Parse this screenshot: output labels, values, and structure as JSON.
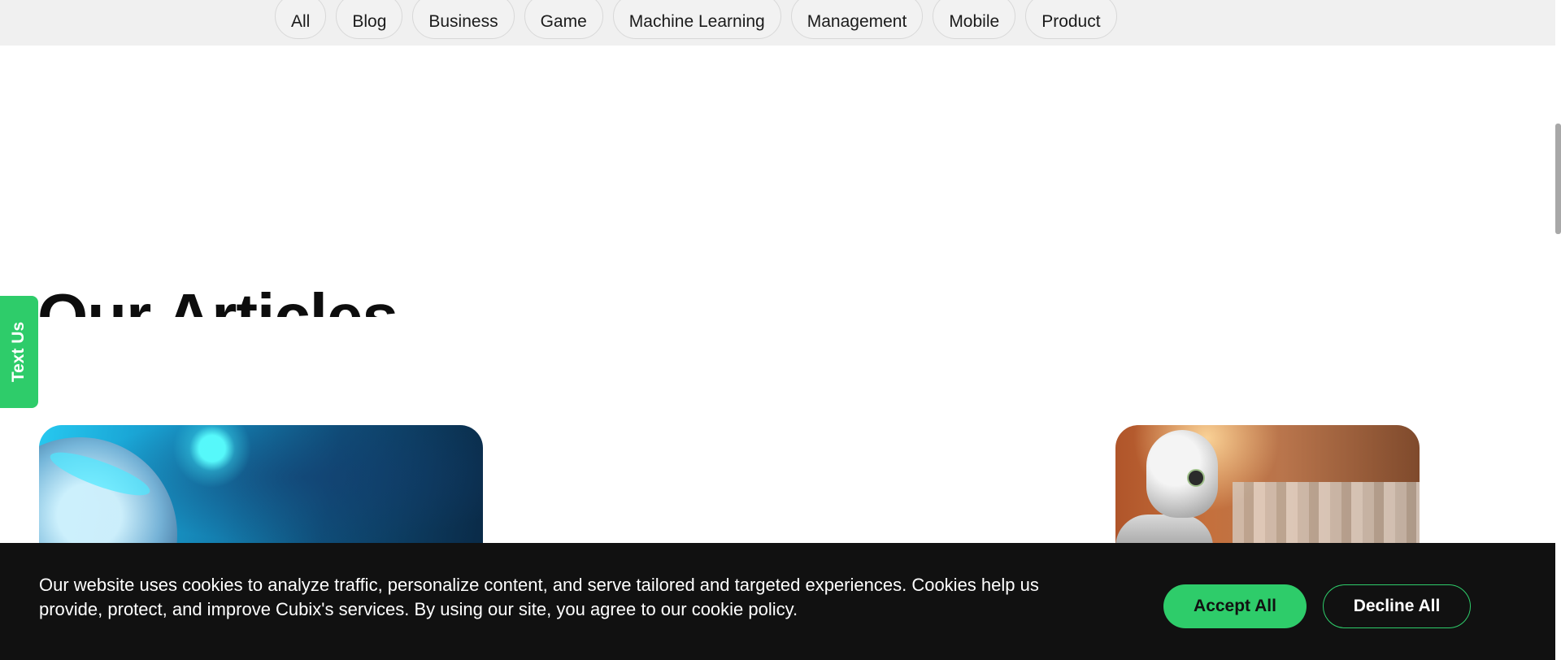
{
  "categories": [
    "All",
    "Blog",
    "Business",
    "Game",
    "Machine Learning",
    "Management",
    "Mobile",
    "Product"
  ],
  "section": {
    "title": "Our Articles"
  },
  "text_us": {
    "label": "Text Us"
  },
  "cookie_banner": {
    "message": "Our website uses cookies to analyze traffic, personalize content, and serve tailored and targeted experiences. Cookies help us provide, protect, and improve Cubix's services. By using our site, you agree to our cookie policy.",
    "accept_label": "Accept All",
    "decline_label": "Decline All"
  },
  "colors": {
    "accent": "#2ecc6a",
    "banner_bg": "#111111",
    "filter_bar_bg": "#f0f0f0"
  },
  "icons": {
    "article_left": "robot-helmet-image",
    "article_right": "robot-shopping-image"
  }
}
